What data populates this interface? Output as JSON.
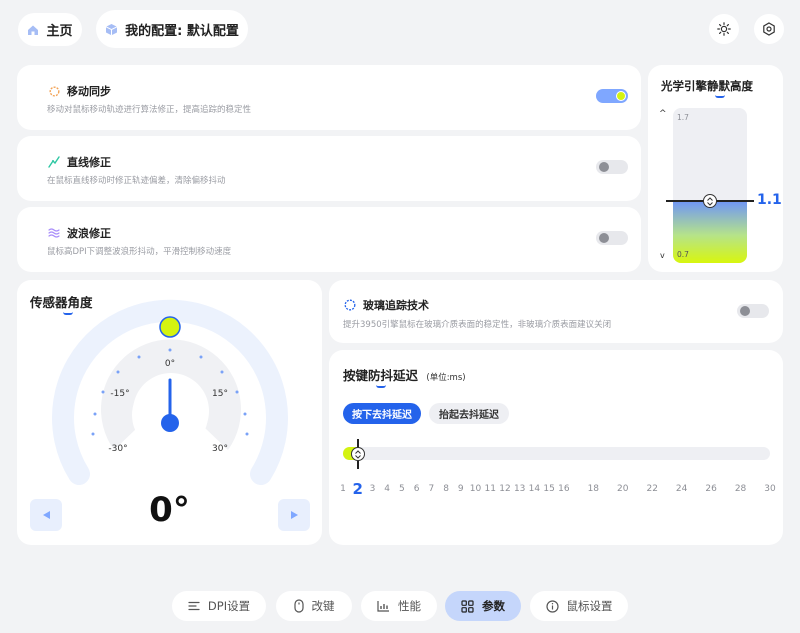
{
  "header": {
    "home_label": "主页",
    "profile_label": "我的配置: 默认配置"
  },
  "motion_rows": [
    {
      "title": "移动同步",
      "desc": "移动对鼠标移动轨迹进行算法修正，提高追踪的稳定性",
      "enabled": true
    },
    {
      "title": "直线修正",
      "desc": "在鼠标直线移动时修正轨迹偏差，清除偏移抖动",
      "enabled": false
    },
    {
      "title": "波浪修正",
      "desc": "鼠标高DPI下调整波浪形抖动，平滑控制移动速度",
      "enabled": false
    }
  ],
  "lod": {
    "title": "光学引擎静默高度",
    "max_label": "1.7",
    "min_label": "0.7",
    "up_label": "^",
    "down_label": "v",
    "value_label": "1.1",
    "min": 0.7,
    "max": 1.7,
    "value": 1.1
  },
  "sensor_angle": {
    "title": "传感器角度",
    "value_label": "0°",
    "labels": [
      "-30°",
      "-15°",
      "0°",
      "15°",
      "30°"
    ]
  },
  "glass": {
    "title": "玻璃追踪技术",
    "desc": "提升3950引擎鼠标在玻璃介质表面的稳定性，非玻璃介质表面建议关闭",
    "enabled": false
  },
  "debounce": {
    "title": "按键防抖延迟",
    "unit": "(单位:ms)",
    "tabs": [
      "按下去抖延迟",
      "抬起去抖延迟"
    ],
    "value": 2,
    "value_label": "2",
    "ticks": [
      "1",
      "2",
      "3",
      "4",
      "5",
      "6",
      "7",
      "8",
      "9",
      "10",
      "11",
      "12",
      "13",
      "14",
      "15",
      "16",
      "18",
      "20",
      "22",
      "24",
      "26",
      "28",
      "30"
    ]
  },
  "bottom_nav": [
    {
      "label": "DPI设置",
      "icon": "sliders-icon",
      "active": false
    },
    {
      "label": "改键",
      "icon": "mouse-icon",
      "active": false
    },
    {
      "label": "性能",
      "icon": "chart-icon",
      "active": false
    },
    {
      "label": "参数",
      "icon": "grid-icon",
      "active": true
    },
    {
      "label": "鼠标设置",
      "icon": "info-icon",
      "active": false
    }
  ],
  "colors": {
    "accent": "#2463eb",
    "toggle_on": "#7fa7ff",
    "lime": "#d4f311",
    "nav_active": "#c5d6fb"
  }
}
